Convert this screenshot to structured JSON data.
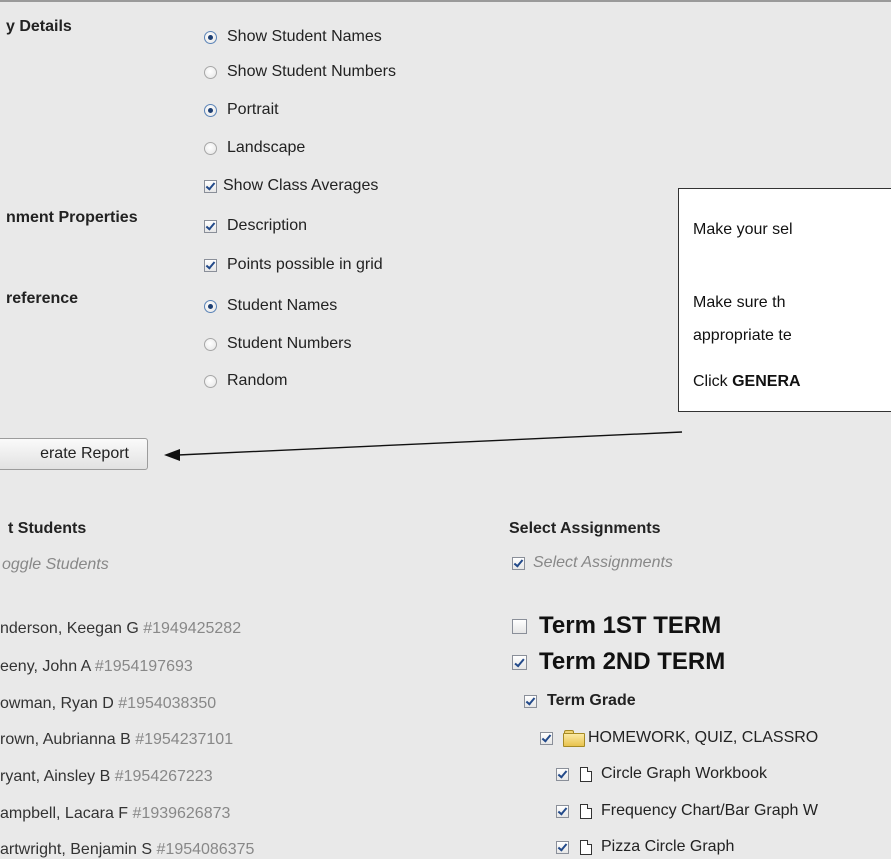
{
  "display_details": {
    "label": "y Details",
    "options": [
      "Show Student Names",
      "Show Student Numbers",
      "Portrait",
      "Landscape",
      "Show Class Averages"
    ]
  },
  "assignment_properties": {
    "label": "nment Properties",
    "options": [
      "Description",
      "Points possible in grid"
    ]
  },
  "preference": {
    "label": "reference",
    "options": [
      "Student Names",
      "Student Numbers",
      "Random"
    ]
  },
  "generate_button": "erate Report",
  "callout": {
    "line1": "Make your sel",
    "line2": "Make sure th",
    "line3": "appropriate te",
    "line4_prefix": "Click ",
    "line4_bold": "GENERA"
  },
  "students": {
    "title": "t Students",
    "toggle": "oggle Students",
    "items": [
      {
        "name": "nderson, Keegan G ",
        "number": "#1949425282"
      },
      {
        "name": "eeny, John A ",
        "number": "#1954197693"
      },
      {
        "name": "owman, Ryan D ",
        "number": "#1954038350"
      },
      {
        "name": "rown, Aubrianna B ",
        "number": "#1954237101"
      },
      {
        "name": "ryant, Ainsley B ",
        "number": "#1954267223"
      },
      {
        "name": "ampbell, Lacara F ",
        "number": "#1939626873"
      },
      {
        "name": "artwright, Benjamin S ",
        "number": "#1954086375"
      }
    ]
  },
  "assignments": {
    "title": "Select Assignments",
    "select_all": "Select Assignments",
    "terms": [
      "Term 1ST TERM",
      "Term 2ND TERM"
    ],
    "term_grade": "Term Grade",
    "category": "HOMEWORK, QUIZ, CLASSRO",
    "items": [
      "Circle Graph Workbook",
      "Frequency Chart/Bar Graph W",
      "Pizza Circle Graph"
    ]
  }
}
